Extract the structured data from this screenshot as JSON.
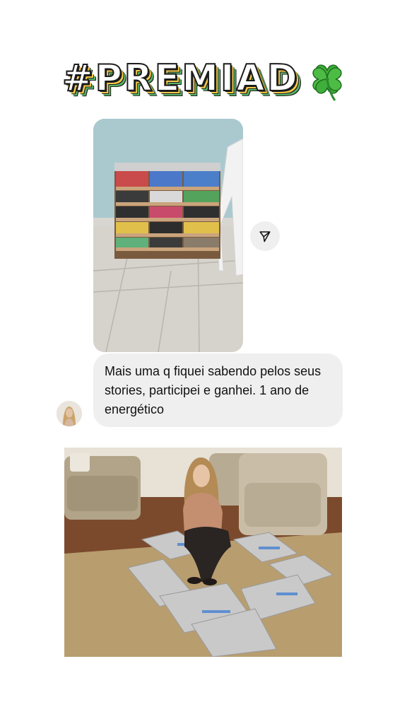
{
  "sticker": {
    "title_text": "#PREMIAD",
    "clover_icon": "four-leaf-clover-icon"
  },
  "conversation": {
    "photo_message": {
      "description_icon": "photo"
    },
    "share_button_icon": "send-paper-plane-icon",
    "avatar_icon": "user-avatar",
    "text_message": "Mais uma q fiquei sabendo pelos seus stories, participei e ganhei. 1 ano de energético"
  },
  "bottom_photo": {
    "icon": "photo"
  },
  "colors": {
    "bubble_bg": "#efefef",
    "page_bg": "#ffffff",
    "text": "#111111",
    "title_shadow_yellow": "#f7c948",
    "title_shadow_green": "#59b56b",
    "clover": "#3fae3a"
  }
}
